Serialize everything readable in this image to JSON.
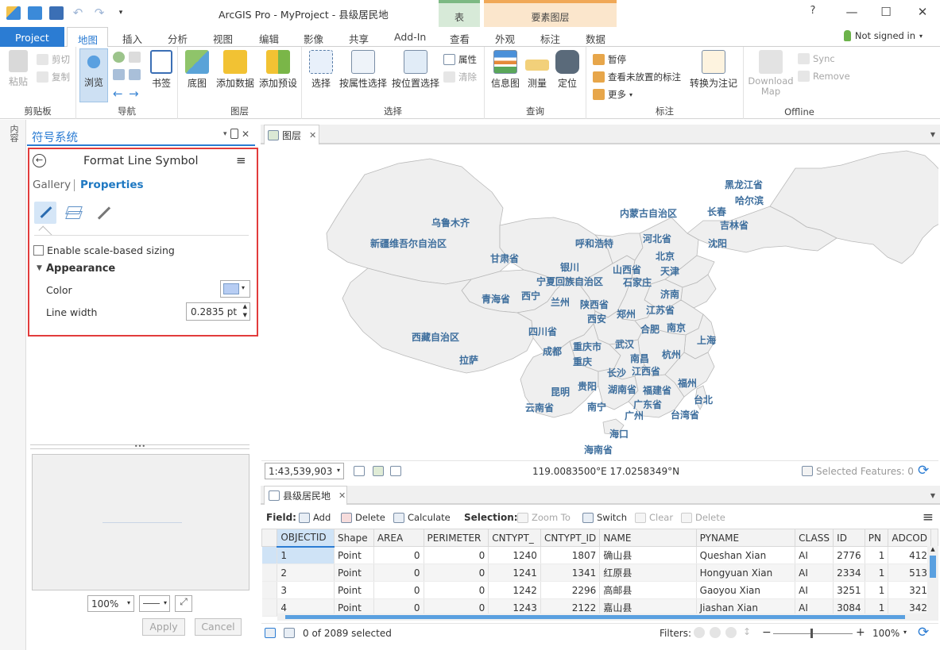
{
  "app": {
    "title": "ArcGIS Pro - MyProject - 县级居民地"
  },
  "context_tabs": {
    "table": "表",
    "feature_layer": "要素图层"
  },
  "ribbon_tabs": [
    "Project",
    "地图",
    "插入",
    "分析",
    "视图",
    "编辑",
    "影像",
    "共享",
    "Add-In",
    "查看",
    "外观",
    "标注",
    "数据"
  ],
  "active_tab": "地图",
  "user": {
    "status": "Not signed in"
  },
  "window_controls": {
    "help": "?",
    "minimize": "—",
    "maximize": "☐",
    "close": "✕"
  },
  "ribbon": {
    "clipboard": {
      "label": "剪贴板",
      "paste": "粘贴",
      "cut": "剪切",
      "copy": "复制"
    },
    "navigate": {
      "label": "导航",
      "explore": "浏览",
      "bookmarks": "书签"
    },
    "layer": {
      "label": "图层",
      "basemap": "底图",
      "add_data": "添加数据",
      "add_preset": "添加预设"
    },
    "selection": {
      "label": "选择",
      "select": "选择",
      "select_by_attr": "按属性选择",
      "select_by_loc": "按位置选择",
      "attributes": "属性",
      "clear": "清除"
    },
    "inquiry": {
      "label": "查询",
      "infographics": "信息图",
      "measure": "测量",
      "locate": "定位"
    },
    "labeling": {
      "label": "标注",
      "pause": "暂停",
      "view_unplaced": "查看未放置的标注",
      "more": "更多",
      "convert": "转换为注记"
    },
    "offline": {
      "label": "Offline",
      "download_map": "Download Map",
      "sync": "Sync",
      "remove": "Remove"
    }
  },
  "left_strip": {
    "label": "内容"
  },
  "symbology": {
    "pane_title": "符号系统",
    "header": "Format Line Symbol",
    "tab_gallery": "Gallery",
    "tab_properties": "Properties",
    "enable_scale": "Enable scale-based sizing",
    "appearance": "Appearance",
    "color_label": "Color",
    "color_value": "#b7cdf3",
    "line_width_label": "Line width",
    "line_width_value": "0.2835 pt",
    "zoom_value": "100%",
    "apply": "Apply",
    "cancel": "Cancel"
  },
  "map": {
    "tab": "图层",
    "scale": "1:43,539,903",
    "coordinates": "119.0083500°E 17.0258349°N",
    "selected_features": "Selected Features: 0",
    "labels": [
      "黑龙江省",
      "哈尔滨",
      "长春",
      "吉林省",
      "内蒙古自治区",
      "乌鲁木齐",
      "呼和浩特",
      "河北省",
      "沈阳",
      "北京",
      "新疆维吾尔自治区",
      "甘肃省",
      "银川",
      "天津",
      "山西省",
      "宁夏回族自治区",
      "石家庄",
      "青海省",
      "西宁",
      "兰州",
      "陕西省",
      "济南",
      "郑州",
      "江苏省",
      "西安",
      "合肥",
      "南京",
      "四川省",
      "上海",
      "西藏自治区",
      "成都",
      "重庆市",
      "武汉",
      "拉萨",
      "重庆",
      "南昌",
      "杭州",
      "长沙",
      "江西省",
      "昆明",
      "贵阳",
      "湖南省",
      "福建省",
      "福州",
      "云南省",
      "南宁",
      "广东省",
      "台北",
      "广州",
      "台湾省",
      "海口",
      "海南省"
    ]
  },
  "attribute_table": {
    "tab": "县级居民地",
    "field_label": "Field:",
    "add": "Add",
    "delete": "Delete",
    "calculate": "Calculate",
    "selection_label": "Selection:",
    "zoom_to": "Zoom To",
    "switch": "Switch",
    "clear": "Clear",
    "delete_sel": "Delete",
    "columns": [
      "OBJECTID",
      "Shape",
      "AREA",
      "PERIMETER",
      "CNTYPT_",
      "CNTYPT_ID",
      "NAME",
      "PYNAME",
      "CLASS",
      "ID",
      "PN",
      "ADCOD"
    ],
    "rows": [
      [
        "1",
        "Point",
        "0",
        "0",
        "1240",
        "1807",
        "确山县",
        "Queshan Xian",
        "AI",
        "2776",
        "1",
        "412"
      ],
      [
        "2",
        "Point",
        "0",
        "0",
        "1241",
        "1341",
        "红原县",
        "Hongyuan Xian",
        "AI",
        "2334",
        "1",
        "513"
      ],
      [
        "3",
        "Point",
        "0",
        "0",
        "1242",
        "2296",
        "高邮县",
        "Gaoyou Xian",
        "AI",
        "3251",
        "1",
        "321"
      ],
      [
        "4",
        "Point",
        "0",
        "0",
        "1243",
        "2122",
        "嘉山县",
        "Jiashan Xian",
        "AI",
        "3084",
        "1",
        "342"
      ]
    ],
    "selected_status": "0 of 2089 selected",
    "filters_label": "Filters:",
    "zoom_percent": "100%"
  }
}
